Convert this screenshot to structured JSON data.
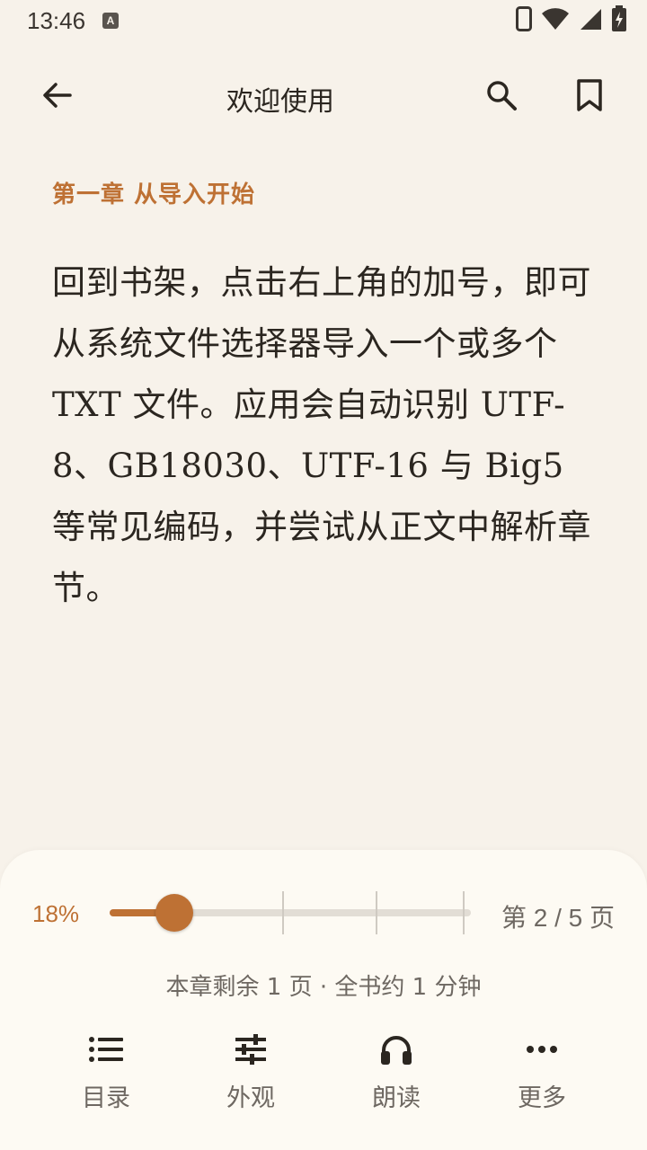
{
  "status_bar": {
    "time": "13:46",
    "notification_badge": "A",
    "icons": [
      "phone-icon",
      "wifi-icon",
      "signal-icon",
      "battery-charging-icon"
    ]
  },
  "app_bar": {
    "title": "欢迎使用",
    "icons": [
      "back-arrow-icon",
      "search-icon",
      "bookmark-icon"
    ]
  },
  "content": {
    "chapter_title": "第一章  从导入开始",
    "paragraph": "回到书架，点击右上角的加号，即可从系统文件选择器导入一个或多个 TXT 文件。应用会自动识别 UTF-8、GB18030、UTF-16 与 Big5 等常见编码，并尝试从正文中解析章节。"
  },
  "reader_panel": {
    "progress_label": "18%",
    "progress_value": 0.18,
    "chapter_marks": [
      0.48,
      0.74,
      0.98
    ],
    "page_indicator": "第 2 / 5 页",
    "remaining_text": "本章剩余 1 页 · 全书约 1 分钟",
    "nav": [
      {
        "label": "目录",
        "icon": "list-icon"
      },
      {
        "label": "外观",
        "icon": "sliders-icon"
      },
      {
        "label": "朗读",
        "icon": "headphones-icon"
      },
      {
        "label": "更多",
        "icon": "more-dots-icon"
      }
    ]
  },
  "colors": {
    "background": "#F7F2EA",
    "panel": "#FDFAF3",
    "accent": "#BE7134",
    "text": "#2B2620",
    "muted": "#6E6862"
  }
}
